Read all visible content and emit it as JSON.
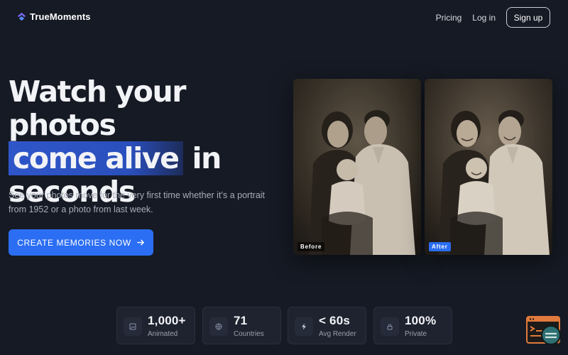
{
  "brand": {
    "name": "TrueMoments",
    "logo_icon": "chevron-up-layers-icon",
    "accent": "#6c63ff"
  },
  "nav": {
    "pricing": "Pricing",
    "login": "Log in",
    "signup": "Sign up"
  },
  "hero": {
    "title_line1": "Watch your photos",
    "title_highlight": "come alive",
    "title_line2_rest": " in",
    "title_line3": "seconds",
    "subtitle": "See your photos move for the very first time whether it’s a portrait from 1952 or a photo from last week.",
    "cta_label": "CREATE MEMORIES NOW",
    "cta_color": "#2b6ef3"
  },
  "photos": {
    "before_label": "Before",
    "after_label": "After"
  },
  "stats": [
    {
      "icon": "image-icon",
      "value": "1,000+",
      "label": "Animated"
    },
    {
      "icon": "globe-icon",
      "value": "71",
      "label": "Countries"
    },
    {
      "icon": "lightning-icon",
      "value": "< 60s",
      "label": "Avg Render"
    },
    {
      "icon": "lock-icon",
      "value": "100%",
      "label": "Private"
    }
  ],
  "widget": {
    "icon": "chat-support-icon"
  }
}
